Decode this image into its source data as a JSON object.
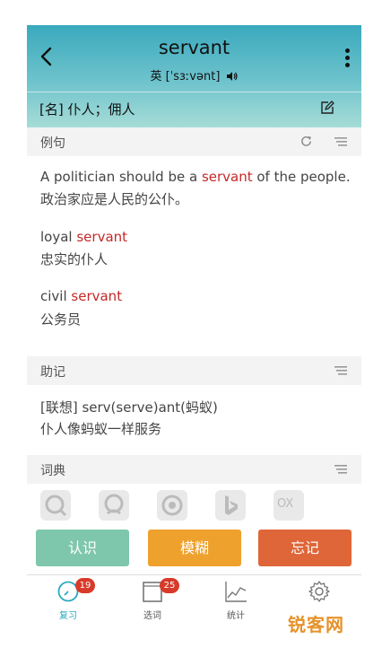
{
  "header": {
    "word": "servant",
    "phonetic": "英 [ˈsɜːvənt]"
  },
  "meaning": "[名] 仆人；佣人",
  "sections": {
    "examples_title": "例句",
    "mnemonic_title": "助记",
    "dictionary_title": "词典"
  },
  "examples": [
    {
      "en_before": "A politician should be a ",
      "en_highlight": "servant",
      "en_after": " of the people.",
      "zh": "政治家应是人民的公仆。"
    },
    {
      "en_before": "loyal ",
      "en_highlight": "servant",
      "en_after": "",
      "zh": "忠实的仆人"
    },
    {
      "en_before": "civil ",
      "en_highlight": "servant",
      "en_after": "",
      "zh": "公务员"
    }
  ],
  "mnemonic": {
    "line1": "[联想] serv(serve)ant(蚂蚁)",
    "line2": "仆人像蚂蚁一样服务"
  },
  "dictionary_icons": [
    "dict-icon-1",
    "dict-icon-2",
    "dict-icon-3",
    "bing-icon",
    "oxford-icon"
  ],
  "dictionary_oxford_label": "OX",
  "buttons": {
    "know": "认识",
    "vague": "模糊",
    "forget": "忘记"
  },
  "tabs": [
    {
      "label": "复习",
      "badge": "19",
      "active": true
    },
    {
      "label": "选词",
      "badge": "25",
      "active": false
    },
    {
      "label": "统计",
      "badge": "",
      "active": false
    },
    {
      "label": "",
      "badge": "",
      "active": false
    }
  ],
  "watermark": "锐客网",
  "colors": {
    "accent": "#3aa9bd",
    "highlight": "#c62828",
    "know": "#7fc7ac",
    "vague": "#efa12e",
    "forget": "#df6638",
    "active_tab": "#2aa9c0",
    "badge": "#d83a2a"
  }
}
